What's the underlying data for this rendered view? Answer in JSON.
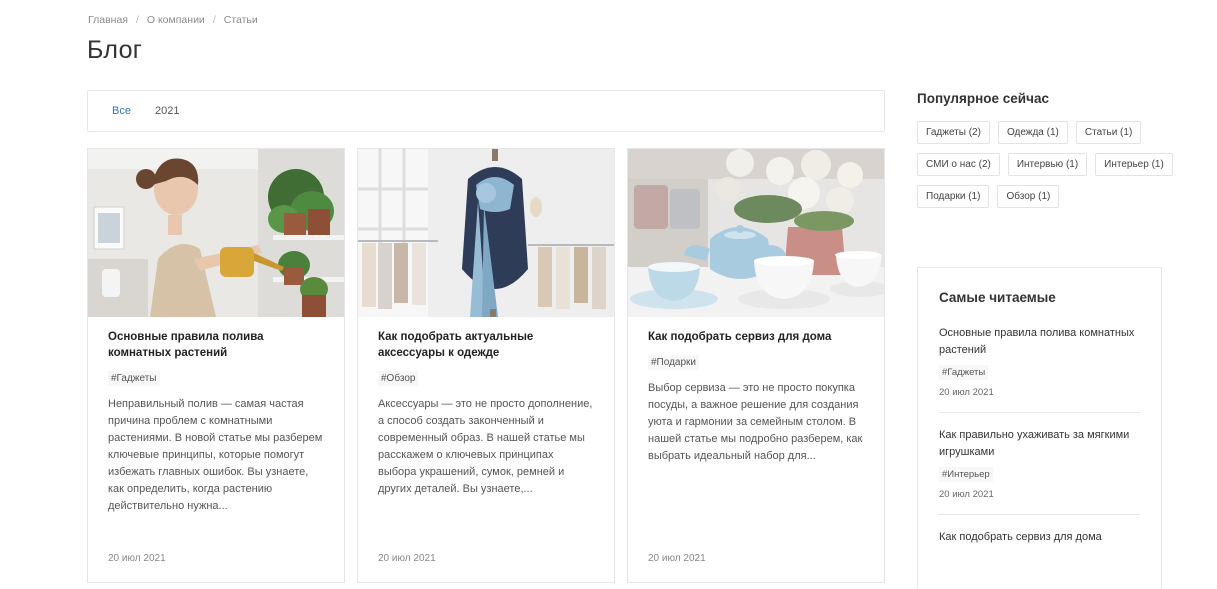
{
  "breadcrumb": {
    "items": [
      "Главная",
      "О компании",
      "Статьи"
    ],
    "separator": "/"
  },
  "page": {
    "title": "Блог"
  },
  "filters": {
    "all": "Все",
    "year": "2021"
  },
  "cards": [
    {
      "title": "Основные правила полива комнатных растений",
      "tag": "#Гаджеты",
      "excerpt": "Неправильный полив — самая частая причина проблем с комнатными растениями. В новой статье мы разберем ключевые принципы, которые помогут избежать главных ошибок. Вы узнаете, как определить, когда растению действительно нужна...",
      "date": "20 июл 2021"
    },
    {
      "title": "Как подобрать актуальные аксессуары к одежде",
      "tag": "#Обзор",
      "excerpt": "Аксессуары — это не просто дополнение, а способ создать законченный и современный образ. В нашей статье мы расскажем о ключевых принципах выбора украшений, сумок, ремней и других деталей. Вы узнаете,...",
      "date": "20 июл 2021"
    },
    {
      "title": "Как подобрать сервиз для дома",
      "tag": "#Подарки",
      "excerpt": "Выбор сервиза — это не просто покупка посуды, а важное решение для создания уюта и гармонии за семейным столом. В нашей статье мы подробно разберем, как выбрать идеальный набор для...",
      "date": "20 июл 2021"
    }
  ],
  "sidebar": {
    "popular_title": "Популярное сейчас",
    "tags": [
      "Гаджеты (2)",
      "Одежда (1)",
      "Статьи (1)",
      "СМИ о нас (2)",
      "Интервью (1)",
      "Интерьер (1)",
      "Подарки (1)",
      "Обзор (1)"
    ],
    "most_read_title": "Самые читаемые",
    "most_read": [
      {
        "title": "Основные правила полива комнатных растений",
        "tag": "#Гаджеты",
        "date": "20 июл 2021"
      },
      {
        "title": "Как правильно ухаживать за мягкими игрушками",
        "tag": "#Интерьер",
        "date": "20 июл 2021"
      },
      {
        "title": "Как подобрать сервиз для дома",
        "tag": "",
        "date": ""
      }
    ]
  },
  "colors": {
    "accent": "#2f75c4",
    "border": "#e6e6e6",
    "text": "#333333"
  }
}
